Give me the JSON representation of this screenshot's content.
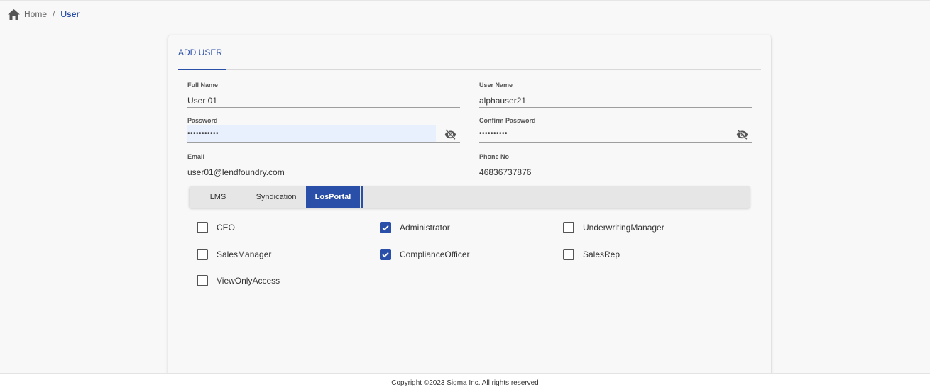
{
  "breadcrumb": {
    "home": "Home",
    "separator": "/",
    "current": "User"
  },
  "card": {
    "tab_label": "ADD USER"
  },
  "form": {
    "full_name": {
      "label": "Full Name",
      "value": "User 01"
    },
    "user_name": {
      "label": "User Name",
      "value": "alphauser21"
    },
    "password": {
      "label": "Password",
      "value": "•••••••••••"
    },
    "confirm_password": {
      "label": "Confirm Password",
      "value": "••••••••••"
    },
    "email": {
      "label": "Email",
      "value": "user01@lendfoundry.com"
    },
    "phone": {
      "label": "Phone No",
      "value": "46836737876"
    }
  },
  "role_tabs": [
    {
      "label": "LMS",
      "active": false
    },
    {
      "label": "Syndication",
      "active": false
    },
    {
      "label": "LosPortal",
      "active": true
    }
  ],
  "roles": [
    {
      "label": "CEO",
      "checked": false
    },
    {
      "label": "Administrator",
      "checked": true
    },
    {
      "label": "UnderwritingManager",
      "checked": false
    },
    {
      "label": "SalesManager",
      "checked": false
    },
    {
      "label": "ComplianceOfficer",
      "checked": true
    },
    {
      "label": "SalesRep",
      "checked": false
    },
    {
      "label": "ViewOnlyAccess",
      "checked": false
    }
  ],
  "footer": {
    "copyright": "Copyright ©2023 Sigma Inc. All rights reserved"
  },
  "colors": {
    "accent": "#2a4fa8",
    "autofill": "#e8f0fe"
  },
  "icons": {
    "home": "home-icon",
    "visibility_off": "visibility-off-icon",
    "check": "check-icon"
  }
}
